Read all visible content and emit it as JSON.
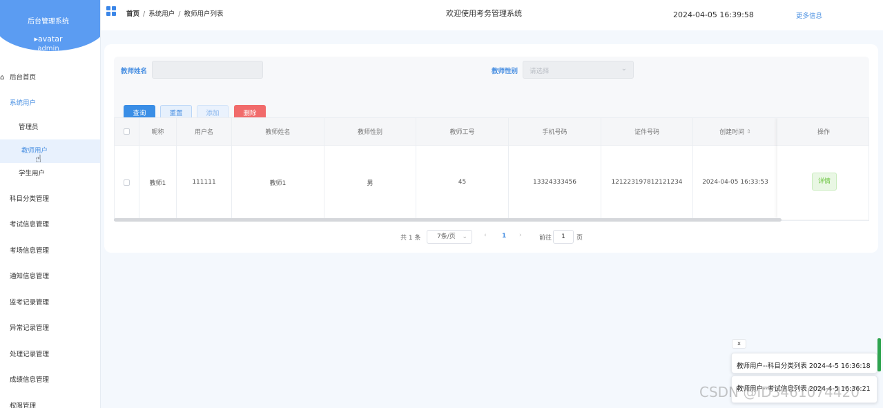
{
  "sidebar": {
    "title": "后台管理系统",
    "avatar_alt": "avatar",
    "username": "admin",
    "items": [
      {
        "label": "后台首页"
      },
      {
        "label": "系统用户"
      },
      {
        "label": "管理员"
      },
      {
        "label": "教师用户"
      },
      {
        "label": "学生用户"
      },
      {
        "label": "科目分类管理"
      },
      {
        "label": "考试信息管理"
      },
      {
        "label": "考场信息管理"
      },
      {
        "label": "通知信息管理"
      },
      {
        "label": "监考记录管理"
      },
      {
        "label": "异常记录管理"
      },
      {
        "label": "处理记录管理"
      },
      {
        "label": "成绩信息管理"
      },
      {
        "label": "权限管理"
      }
    ]
  },
  "header": {
    "breadcrumb": [
      "首页",
      "系统用户",
      "教师用户列表"
    ],
    "separator": "/",
    "welcome": "欢迎使用考务管理系统",
    "datetime": "2024-04-05 16:39:58",
    "more": "更多信息"
  },
  "filter": {
    "name_label": "教师姓名",
    "name_value": "",
    "gender_label": "教师性别",
    "gender_placeholder": "请选择"
  },
  "buttons": {
    "query": "查询",
    "reset": "重置",
    "add": "添加",
    "delete": "删除"
  },
  "table": {
    "columns": [
      "昵称",
      "用户名",
      "教师姓名",
      "教师性别",
      "教师工号",
      "手机号码",
      "证件号码",
      "创建时间",
      "操作"
    ],
    "rows": [
      {
        "nickname": "教师1",
        "username": "111111",
        "name": "教师1",
        "gender": "男",
        "staff_no": "45",
        "phone": "13324333456",
        "id_no": "121223197812121234",
        "created": "2024-04-05 16:33:53",
        "action": "详情"
      }
    ]
  },
  "pagination": {
    "total": "共 1 条",
    "page_size": "7条/页",
    "current": "1",
    "goto_label": "前往",
    "goto_value": "1",
    "page_suffix": "页"
  },
  "notifications": {
    "close": "x",
    "items": [
      "教师用户--科目分类列表 2024-4-5 16:36:18",
      "教师用户--考试信息列表 2024-4-5 16:36:21"
    ]
  },
  "watermark": "CSDN @ID3461074420",
  "colors": {
    "primary": "#3a8ee6",
    "danger": "#f16b6b",
    "success": "#67c23a",
    "sidebar_header": "#5b9cf2"
  }
}
